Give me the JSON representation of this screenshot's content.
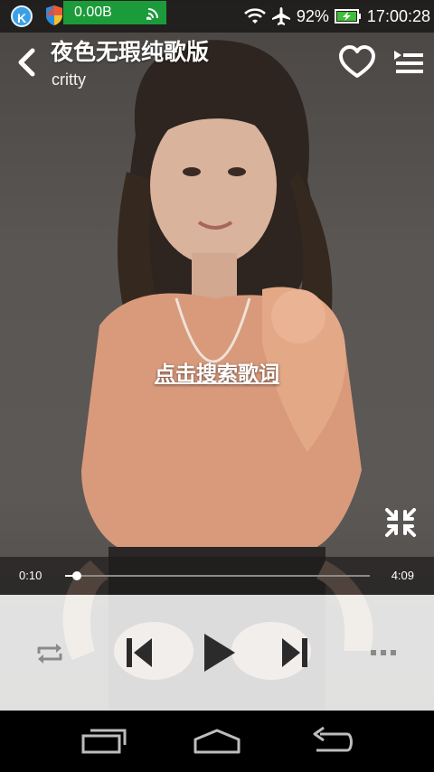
{
  "status_bar": {
    "net_speed": "0.00B",
    "battery": "92%",
    "time": "17:00:28",
    "icons": [
      "k-app-icon",
      "shield-icon",
      "signal-icon",
      "wifi-icon",
      "airplane-icon",
      "battery-charging-icon"
    ]
  },
  "song": {
    "title": "夜色无瑕纯歌版",
    "artist": "critty"
  },
  "lyrics": {
    "hint": "点击搜索歌词"
  },
  "playback": {
    "current_time": "0:10",
    "total_time": "4:09",
    "progress": 0.04
  },
  "controls": {
    "icons": [
      "repeat-icon",
      "previous-icon",
      "play-icon",
      "next-icon",
      "more-icon"
    ]
  },
  "nav": {
    "icons": [
      "recent-apps-icon",
      "home-icon",
      "back-icon"
    ]
  },
  "colors": {
    "accent_green": "#1c9b3a",
    "controls_bg": "#f6f6f6",
    "icon_dark": "#2b2b2b"
  }
}
